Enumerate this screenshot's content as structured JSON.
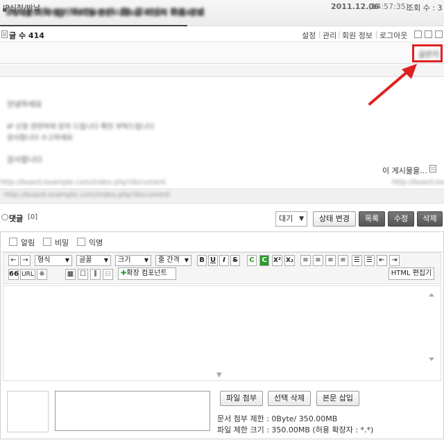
{
  "header": {
    "site_title": "Board Img Network Bulletin Board"
  },
  "topbar": {
    "count_label": "글 수",
    "count_value": "414",
    "links": [
      "설정",
      "관리",
      "회원 정보",
      "로그아웃"
    ]
  },
  "post": {
    "title": "게시물 제목 블러 처리됨  본문 내용  글 작성자 이름 정보",
    "author": "글쓴이",
    "category": "IP신청/반납",
    "date": "2011.12.06",
    "time": "(14:57:35)",
    "views_label": "조회 수 : 3",
    "body_lines": [
      "안녕하세요",
      "IP 신청 관련하여 문의 드립니다 확인 부탁드립니다",
      "감사합니다 수고하세요",
      "감사합니다"
    ],
    "signature_link": "이 게시물을...",
    "footer_left": "http://board.example.com/index.php?document",
    "footer_right": "http://board.example"
  },
  "comments": {
    "label": "댓글",
    "count": "[0]",
    "status_value": "대기",
    "buttons": {
      "change_status": "상태 변경",
      "list": "목록",
      "edit": "수정",
      "delete": "삭제"
    }
  },
  "editor": {
    "options": [
      "알림",
      "비밀",
      "익명"
    ],
    "selects": {
      "format": "형식",
      "font": "글꼴",
      "size": "크기",
      "line_height": "줄 간격"
    },
    "format_buttons": [
      "B",
      "U",
      "I",
      "S",
      "C",
      "C",
      "X²",
      "X₂"
    ],
    "quote_label": "66",
    "url_label": "URL",
    "symbol_label": "※",
    "extension_button": "확장 컴포넌트",
    "html_button": "HTML 편집기"
  },
  "attachments": {
    "attach_button": "파일 첨부",
    "delete_button": "선택 삭제",
    "insert_button": "본문 삽입",
    "doc_limit": "문서 첨부 제한 : 0Byte/ 350.00MB",
    "file_limit": "파일 제한 크기 : 350.00MB (허용 확장자 : *.*)"
  },
  "colors": {
    "highlight": "#e02020",
    "dark_button": "#555555"
  }
}
